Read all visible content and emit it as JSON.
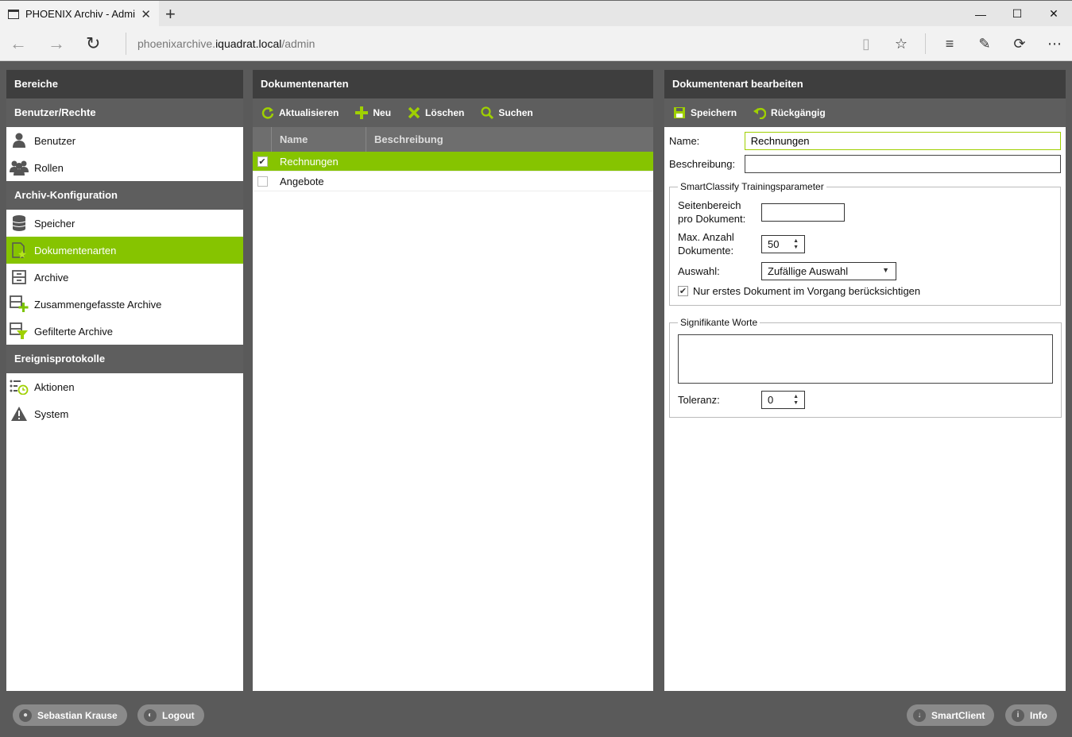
{
  "browser": {
    "tab_title": "PHOENIX Archiv - Admi",
    "url_prefix": "phoenixarchive.",
    "url_host": "iquadrat.local",
    "url_path": "/admin"
  },
  "left": {
    "header": "Bereiche",
    "sections": [
      {
        "title": "Benutzer/Rechte",
        "items": [
          {
            "label": "Benutzer",
            "icon": "user-icon"
          },
          {
            "label": "Rollen",
            "icon": "users-icon"
          }
        ]
      },
      {
        "title": "Archiv-Konfiguration",
        "items": [
          {
            "label": "Speicher",
            "icon": "database-icon"
          },
          {
            "label": "Dokumentenarten",
            "icon": "document-type-icon"
          },
          {
            "label": "Archive",
            "icon": "archive-icon"
          },
          {
            "label": "Zusammengefasste Archive",
            "icon": "combined-archive-icon"
          },
          {
            "label": "Gefilterte Archive",
            "icon": "filtered-archive-icon"
          }
        ]
      },
      {
        "title": "Ereignisprotokolle",
        "items": [
          {
            "label": "Aktionen",
            "icon": "actions-icon"
          },
          {
            "label": "System",
            "icon": "warning-icon"
          }
        ]
      }
    ]
  },
  "mid": {
    "header": "Dokumentenarten",
    "toolbar": {
      "refresh": "Aktualisieren",
      "new": "Neu",
      "delete": "Löschen",
      "search": "Suchen"
    },
    "columns": {
      "name": "Name",
      "description": "Beschreibung"
    },
    "rows": [
      {
        "name": "Rechnungen",
        "description": "",
        "checked": true
      },
      {
        "name": "Angebote",
        "description": "",
        "checked": false
      }
    ]
  },
  "right": {
    "header": "Dokumentenart bearbeiten",
    "toolbar": {
      "save": "Speichern",
      "undo": "Rückgängig"
    },
    "name_label": "Name:",
    "name_value": "Rechnungen",
    "desc_label": "Beschreibung:",
    "desc_value": "",
    "training": {
      "legend": "SmartClassify Trainingsparameter",
      "page_range_label_1": "Seitenbereich",
      "page_range_label_2": "pro Dokument:",
      "page_range_value": "",
      "max_docs_label_1": "Max. Anzahl",
      "max_docs_label_2": "Dokumente:",
      "max_docs_value": "50",
      "selection_label": "Auswahl:",
      "selection_value": "Zufällige Auswahl",
      "first_doc_label": "Nur erstes Dokument im Vorgang berücksichtigen"
    },
    "significant": {
      "legend": "Signifikante Worte",
      "tolerance_label": "Toleranz:",
      "tolerance_value": "0"
    }
  },
  "footer": {
    "user": "Sebastian Krause",
    "logout": "Logout",
    "smartclient": "SmartClient",
    "info": "Info"
  },
  "colors": {
    "accent": "#86c400",
    "header": "#3e3e3e",
    "section": "#5e5e5e"
  }
}
